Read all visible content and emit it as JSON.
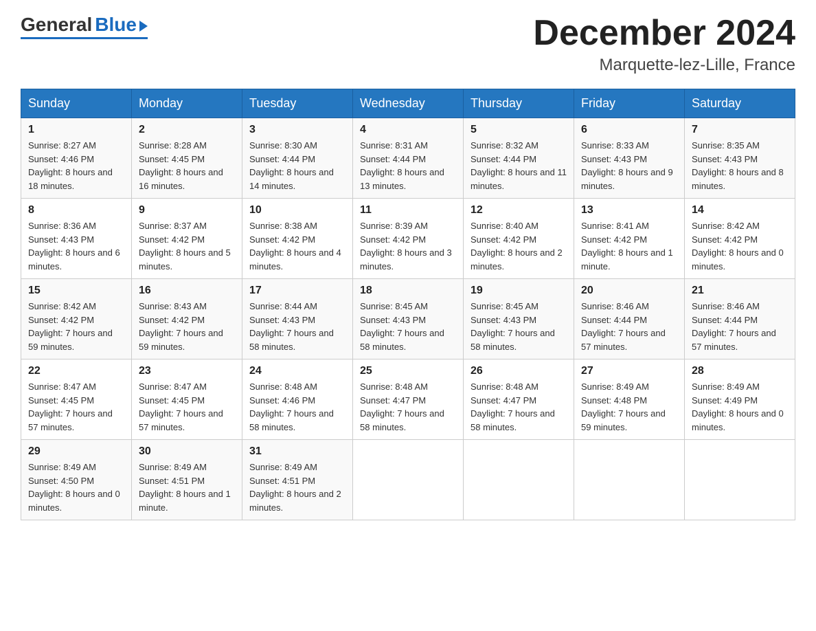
{
  "header": {
    "logo_general": "General",
    "logo_blue": "Blue",
    "month_year": "December 2024",
    "location": "Marquette-lez-Lille, France"
  },
  "days_of_week": [
    "Sunday",
    "Monday",
    "Tuesday",
    "Wednesday",
    "Thursday",
    "Friday",
    "Saturday"
  ],
  "weeks": [
    [
      {
        "day": "1",
        "sunrise": "8:27 AM",
        "sunset": "4:46 PM",
        "daylight": "8 hours and 18 minutes."
      },
      {
        "day": "2",
        "sunrise": "8:28 AM",
        "sunset": "4:45 PM",
        "daylight": "8 hours and 16 minutes."
      },
      {
        "day": "3",
        "sunrise": "8:30 AM",
        "sunset": "4:44 PM",
        "daylight": "8 hours and 14 minutes."
      },
      {
        "day": "4",
        "sunrise": "8:31 AM",
        "sunset": "4:44 PM",
        "daylight": "8 hours and 13 minutes."
      },
      {
        "day": "5",
        "sunrise": "8:32 AM",
        "sunset": "4:44 PM",
        "daylight": "8 hours and 11 minutes."
      },
      {
        "day": "6",
        "sunrise": "8:33 AM",
        "sunset": "4:43 PM",
        "daylight": "8 hours and 9 minutes."
      },
      {
        "day": "7",
        "sunrise": "8:35 AM",
        "sunset": "4:43 PM",
        "daylight": "8 hours and 8 minutes."
      }
    ],
    [
      {
        "day": "8",
        "sunrise": "8:36 AM",
        "sunset": "4:43 PM",
        "daylight": "8 hours and 6 minutes."
      },
      {
        "day": "9",
        "sunrise": "8:37 AM",
        "sunset": "4:42 PM",
        "daylight": "8 hours and 5 minutes."
      },
      {
        "day": "10",
        "sunrise": "8:38 AM",
        "sunset": "4:42 PM",
        "daylight": "8 hours and 4 minutes."
      },
      {
        "day": "11",
        "sunrise": "8:39 AM",
        "sunset": "4:42 PM",
        "daylight": "8 hours and 3 minutes."
      },
      {
        "day": "12",
        "sunrise": "8:40 AM",
        "sunset": "4:42 PM",
        "daylight": "8 hours and 2 minutes."
      },
      {
        "day": "13",
        "sunrise": "8:41 AM",
        "sunset": "4:42 PM",
        "daylight": "8 hours and 1 minute."
      },
      {
        "day": "14",
        "sunrise": "8:42 AM",
        "sunset": "4:42 PM",
        "daylight": "8 hours and 0 minutes."
      }
    ],
    [
      {
        "day": "15",
        "sunrise": "8:42 AM",
        "sunset": "4:42 PM",
        "daylight": "7 hours and 59 minutes."
      },
      {
        "day": "16",
        "sunrise": "8:43 AM",
        "sunset": "4:42 PM",
        "daylight": "7 hours and 59 minutes."
      },
      {
        "day": "17",
        "sunrise": "8:44 AM",
        "sunset": "4:43 PM",
        "daylight": "7 hours and 58 minutes."
      },
      {
        "day": "18",
        "sunrise": "8:45 AM",
        "sunset": "4:43 PM",
        "daylight": "7 hours and 58 minutes."
      },
      {
        "day": "19",
        "sunrise": "8:45 AM",
        "sunset": "4:43 PM",
        "daylight": "7 hours and 58 minutes."
      },
      {
        "day": "20",
        "sunrise": "8:46 AM",
        "sunset": "4:44 PM",
        "daylight": "7 hours and 57 minutes."
      },
      {
        "day": "21",
        "sunrise": "8:46 AM",
        "sunset": "4:44 PM",
        "daylight": "7 hours and 57 minutes."
      }
    ],
    [
      {
        "day": "22",
        "sunrise": "8:47 AM",
        "sunset": "4:45 PM",
        "daylight": "7 hours and 57 minutes."
      },
      {
        "day": "23",
        "sunrise": "8:47 AM",
        "sunset": "4:45 PM",
        "daylight": "7 hours and 57 minutes."
      },
      {
        "day": "24",
        "sunrise": "8:48 AM",
        "sunset": "4:46 PM",
        "daylight": "7 hours and 58 minutes."
      },
      {
        "day": "25",
        "sunrise": "8:48 AM",
        "sunset": "4:47 PM",
        "daylight": "7 hours and 58 minutes."
      },
      {
        "day": "26",
        "sunrise": "8:48 AM",
        "sunset": "4:47 PM",
        "daylight": "7 hours and 58 minutes."
      },
      {
        "day": "27",
        "sunrise": "8:49 AM",
        "sunset": "4:48 PM",
        "daylight": "7 hours and 59 minutes."
      },
      {
        "day": "28",
        "sunrise": "8:49 AM",
        "sunset": "4:49 PM",
        "daylight": "8 hours and 0 minutes."
      }
    ],
    [
      {
        "day": "29",
        "sunrise": "8:49 AM",
        "sunset": "4:50 PM",
        "daylight": "8 hours and 0 minutes."
      },
      {
        "day": "30",
        "sunrise": "8:49 AM",
        "sunset": "4:51 PM",
        "daylight": "8 hours and 1 minute."
      },
      {
        "day": "31",
        "sunrise": "8:49 AM",
        "sunset": "4:51 PM",
        "daylight": "8 hours and 2 minutes."
      },
      null,
      null,
      null,
      null
    ]
  ],
  "labels": {
    "sunrise_label": "Sunrise:",
    "sunset_label": "Sunset:",
    "daylight_label": "Daylight:"
  }
}
